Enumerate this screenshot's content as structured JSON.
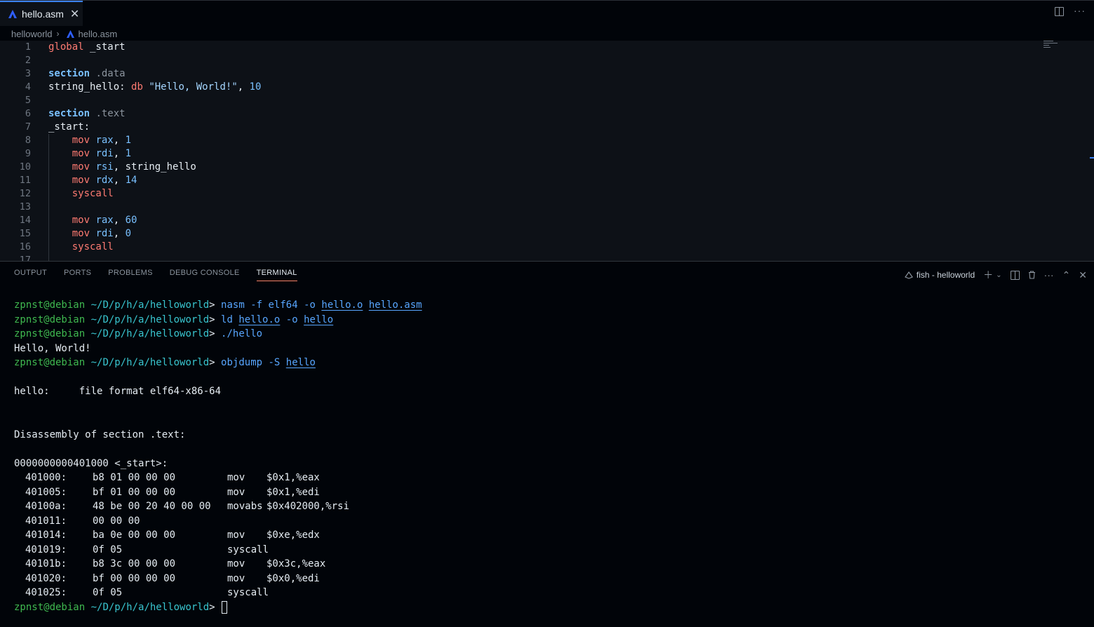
{
  "tab": {
    "label": "hello.asm"
  },
  "breadcrumb": {
    "folder": "helloworld",
    "file": "hello.asm"
  },
  "editor": {
    "line_numbers": [
      "1",
      "2",
      "3",
      "4",
      "5",
      "6",
      "7",
      "8",
      "9",
      "10",
      "11",
      "12",
      "13",
      "14",
      "15",
      "16",
      "17"
    ]
  },
  "panel": {
    "tabs": [
      "OUTPUT",
      "PORTS",
      "PROBLEMS",
      "DEBUG CONSOLE",
      "TERMINAL"
    ],
    "active_tab": "TERMINAL",
    "terminal_name": "fish - helloworld"
  },
  "terminal": {
    "user": "zpnst@debian",
    "cwd": "~/D/p/h/a/helloworld",
    "prompt_char": ">",
    "commands": [
      "nasm -f elf64 -o hello.o hello.asm",
      "ld hello.o -o hello",
      "./hello",
      "objdump -S hello"
    ],
    "program_output": "Hello, World!",
    "objdump_header": "hello:     file format elf64-x86-64",
    "disassembly_title": "Disassembly of section .text:",
    "symbol_line": "0000000000401000 <_start>:",
    "disassembly": [
      {
        "addr": "401000:",
        "bytes": "b8 01 00 00 00",
        "mnemonic": "mov",
        "operands": "$0x1,%eax"
      },
      {
        "addr": "401005:",
        "bytes": "bf 01 00 00 00",
        "mnemonic": "mov",
        "operands": "$0x1,%edi"
      },
      {
        "addr": "40100a:",
        "bytes": "48 be 00 20 40 00 00",
        "mnemonic": "movabs",
        "operands": "$0x402000,%rsi"
      },
      {
        "addr": "401011:",
        "bytes": "00 00 00",
        "mnemonic": "",
        "operands": ""
      },
      {
        "addr": "401014:",
        "bytes": "ba 0e 00 00 00",
        "mnemonic": "mov",
        "operands": "$0xe,%edx"
      },
      {
        "addr": "401019:",
        "bytes": "0f 05",
        "mnemonic": "syscall",
        "operands": ""
      },
      {
        "addr": "40101b:",
        "bytes": "b8 3c 00 00 00",
        "mnemonic": "mov",
        "operands": "$0x3c,%eax"
      },
      {
        "addr": "401020:",
        "bytes": "bf 00 00 00 00",
        "mnemonic": "mov",
        "operands": "$0x0,%edi"
      },
      {
        "addr": "401025:",
        "bytes": "0f 05",
        "mnemonic": "syscall",
        "operands": ""
      }
    ]
  },
  "colors": {
    "accent": "#3b82f6",
    "prompt_user": "#3fb950",
    "prompt_path": "#39c5cf"
  },
  "icons": [
    "asm-file-icon",
    "close-icon",
    "split-editor-icon",
    "more-actions-icon",
    "terminal-icon",
    "plus-icon",
    "chevron-down-icon",
    "trash-icon",
    "chevron-up-icon"
  ]
}
